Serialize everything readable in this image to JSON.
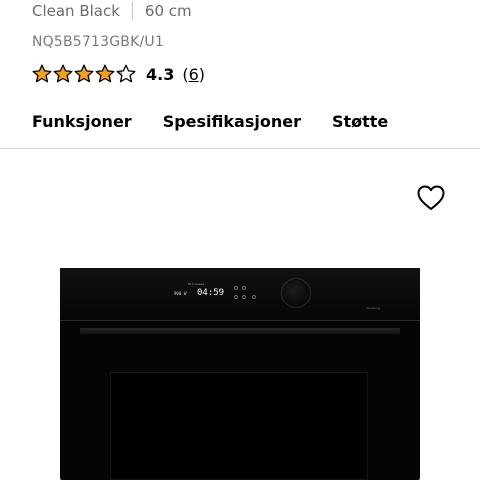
{
  "product": {
    "color_label": "Clean Black",
    "size_label": "60 cm",
    "model_code": "NQ5B5713GBK/U1",
    "rating": {
      "value": "4.3",
      "count": "6",
      "stars": 4.3,
      "max_stars": 5,
      "star_color": "#f4a11f",
      "star_outline_color": "#000000"
    }
  },
  "tabs": [
    {
      "label": "Funksjoner"
    },
    {
      "label": "Spesifikasjoner"
    },
    {
      "label": "Støtte"
    }
  ],
  "favorite_icon": "heart-outline-icon",
  "oven_display": {
    "mode_text": "Microwave",
    "power_text": "900",
    "unit_text": "W",
    "time_text": "04:59",
    "brand_text": "Samsung"
  }
}
